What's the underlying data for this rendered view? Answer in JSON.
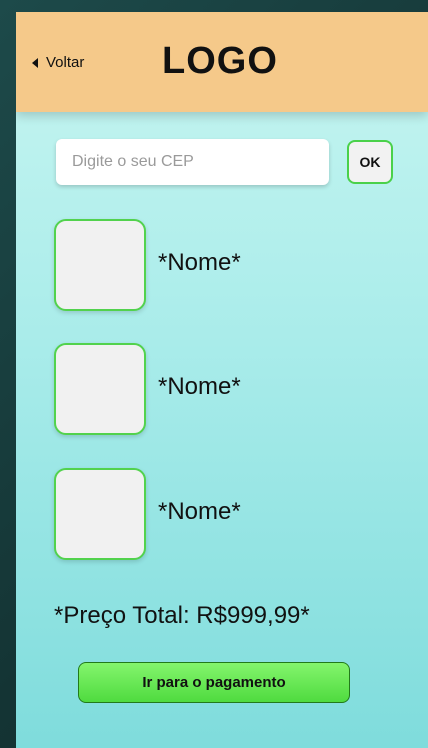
{
  "header": {
    "back_label": "Voltar",
    "logo_text": "LOGO"
  },
  "cep": {
    "placeholder": "Digite o seu CEP",
    "value": "",
    "ok_label": "OK"
  },
  "products": [
    {
      "name": "*Nome*"
    },
    {
      "name": "*Nome*"
    },
    {
      "name": "*Nome*"
    }
  ],
  "total_label": "*Preço Total: R$999,99*",
  "pay_button_label": "Ir para o pagamento",
  "colors": {
    "header_bg": "#f5c98a",
    "accent_green": "#4ad14a",
    "background_top": "#c8f6f1",
    "background_bottom": "#7fdcdc"
  }
}
